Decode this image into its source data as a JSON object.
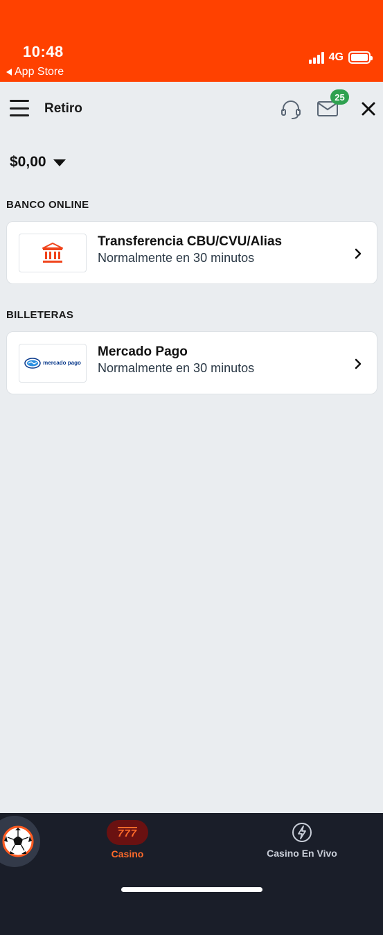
{
  "status_bar": {
    "time": "10:48",
    "back_label": "App Store",
    "network": "4G"
  },
  "header": {
    "title": "Retiro",
    "mail_badge": "25"
  },
  "balance": {
    "amount": "$0,00"
  },
  "sections": [
    {
      "title": "BANCO ONLINE",
      "method": {
        "title": "Transferencia CBU/CVU/Alias",
        "subtitle": "Normalmente en 30 minutos",
        "icon": "bank-icon"
      }
    },
    {
      "title": "BILLETERAS",
      "method": {
        "title": "Mercado Pago",
        "subtitle": "Normalmente en 30 minutos",
        "icon": "mercado-pago-logo",
        "logo_text": "mercado pago"
      }
    }
  ],
  "bottom_nav": {
    "items": [
      {
        "label": "Casino",
        "active": true,
        "icon": "casino-777-icon"
      },
      {
        "label": "Casino En Vivo",
        "active": false,
        "icon": "lightning-icon"
      }
    ]
  },
  "colors": {
    "brand_orange": "#ff4100",
    "badge_green": "#2fa150",
    "nav_bg": "#1a1e29",
    "active_nav": "#ff6a2a"
  }
}
